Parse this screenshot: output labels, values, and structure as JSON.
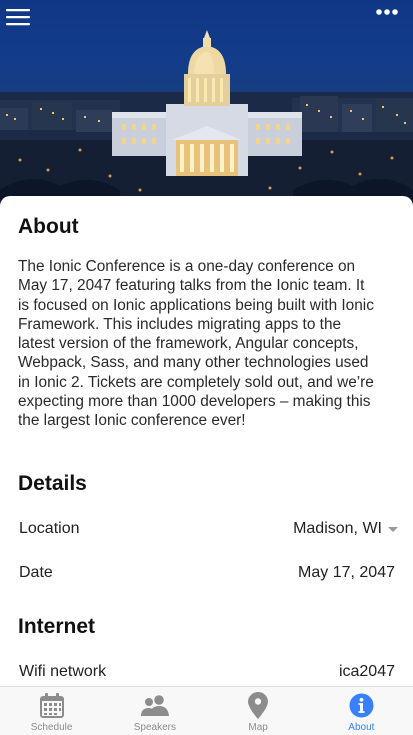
{
  "header": {
    "menu_icon": "hamburger-menu-icon",
    "more_icon": "more-horizontal-icon",
    "hero_image": "state-capitol-night-photo"
  },
  "about": {
    "title": "About",
    "lines": [
      "The Ionic Conference is a one-day conference on",
      "May 17, 2047 featuring talks from the Ionic team. It",
      "is focused on Ionic applications being built with Ionic",
      "Framework. This includes migrating apps to the",
      "latest version of the framework, Angular concepts,",
      "Webpack, Sass, and many other technologies used",
      "in Ionic 2. Tickets are completely sold out, and we’re",
      "expecting more than 1000 developers – making this",
      "the largest Ionic conference ever!"
    ]
  },
  "details": {
    "title": "Details",
    "location_label": "Location",
    "location_value": "Madison, WI",
    "date_label": "Date",
    "date_value": "May 17, 2047"
  },
  "internet": {
    "title": "Internet",
    "wifi_label": "Wifi network",
    "wifi_value": "ica2047"
  },
  "tabs": [
    {
      "label": "Schedule",
      "icon": "calendar-icon",
      "active": false
    },
    {
      "label": "Speakers",
      "icon": "people-icon",
      "active": false
    },
    {
      "label": "Map",
      "icon": "map-pin-icon",
      "active": false
    },
    {
      "label": "About",
      "icon": "info-icon",
      "active": true
    }
  ],
  "colors": {
    "accent": "#3880ff",
    "tab_inactive": "#8c8c8c",
    "sky": "#133c8a"
  }
}
